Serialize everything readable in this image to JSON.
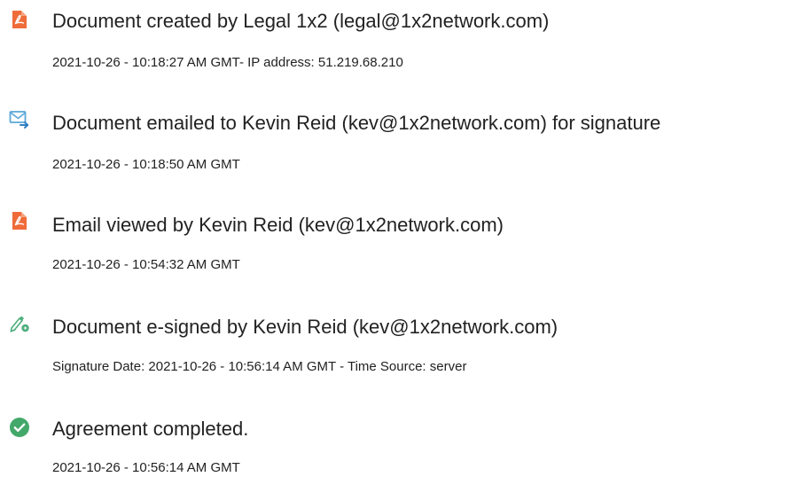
{
  "events": [
    {
      "icon": "document-created-icon",
      "title": "Document created by Legal 1x2 (legal@1x2network.com)",
      "detail": "2021-10-26 - 10:18:27 AM GMT- IP address: 51.219.68.210"
    },
    {
      "icon": "email-sent-icon",
      "title": "Document emailed to Kevin Reid (kev@1x2network.com) for signature",
      "detail": "2021-10-26 - 10:18:50 AM GMT"
    },
    {
      "icon": "document-viewed-icon",
      "title": "Email viewed by Kevin Reid (kev@1x2network.com)",
      "detail": "2021-10-26 - 10:54:32 AM GMT"
    },
    {
      "icon": "e-sign-pen-icon",
      "title": "Document e-signed by Kevin Reid (kev@1x2network.com)",
      "detail": "Signature Date: 2021-10-26 - 10:56:14 AM GMT - Time Source: server"
    },
    {
      "icon": "check-circle-icon",
      "title": "Agreement completed.",
      "detail": "2021-10-26 - 10:56:14 AM GMT"
    }
  ],
  "colors": {
    "acrobat_orange": "#ef6c3a",
    "email_blue": "#5aa7d8",
    "pen_green": "#4caf7c",
    "check_green": "#43a86a",
    "text": "#222222"
  }
}
